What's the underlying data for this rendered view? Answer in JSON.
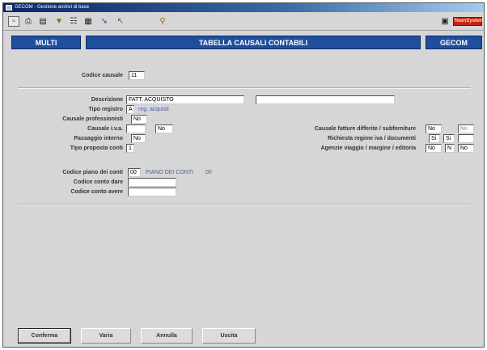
{
  "window": {
    "title": "GECOM - Gestione archivi di base"
  },
  "toolbar": {
    "icons": [
      "window-icon",
      "printer-icon",
      "print-preview-icon",
      "filter-icon",
      "network-icon",
      "calculator-icon",
      "arrow-icon",
      "cursor-icon",
      "pin-icon",
      "company-logo-icon"
    ],
    "brand_label": "TeamSystem"
  },
  "header": {
    "left": "MULTI",
    "center": "TABELLA CAUSALI CONTABILI",
    "right": "GECOM"
  },
  "form": {
    "codice_causale": {
      "label": "Codice causale",
      "value": "11"
    },
    "descrizione": {
      "label": "Descrizione",
      "value": "FATT. ACQUISTO",
      "value2": ""
    },
    "tipo_registro": {
      "label": "Tipo registro",
      "value": "A",
      "desc": "reg. acquisti"
    },
    "causale_professionisti": {
      "label": "Causale professionisti",
      "value": "No"
    },
    "causale_iva": {
      "label": "Causale i.v.a.",
      "value": "",
      "value2": "No"
    },
    "passaggio_interno": {
      "label": "Passaggio interno",
      "value": "No"
    },
    "tipo_proposta_conti": {
      "label": "Tipo proposta conti",
      "value": "1"
    },
    "causale_fatture": {
      "label": "Causale fatture differite / subforniture",
      "value": "No",
      "value2": "No"
    },
    "richiesta_regime": {
      "label": "Richiesta regime iva / documenti",
      "value": "Si",
      "value2": "Si",
      "value3": ""
    },
    "agenzie_viaggio": {
      "label": "Agenzie viaggio / margine / editoria",
      "value": "No",
      "value2": "N",
      "value3": "No"
    },
    "codice_piano_conti": {
      "label": "Codice piano dei conti",
      "value": "00",
      "desc": "PIANO DEI CONTI",
      "desc2": "00"
    },
    "codice_conto_dare": {
      "label": "Codice conto dare",
      "value": ""
    },
    "codice_conto_avere": {
      "label": "Codice conto avere",
      "value": ""
    }
  },
  "buttons": {
    "conferma": "Conferma",
    "varia": "Varia",
    "annulla": "Annulla",
    "uscita": "Uscita"
  }
}
